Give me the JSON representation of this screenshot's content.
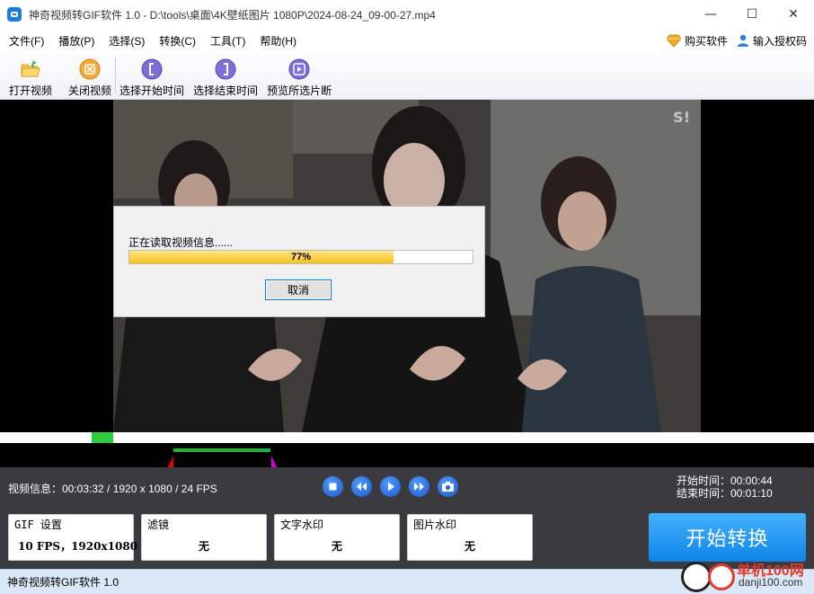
{
  "window": {
    "title": "神奇视频转GIF软件 1.0 - D:\\tools\\桌面\\4K壁纸图片 1080P\\2024-08-24_09-00-27.mp4",
    "controls": {
      "minimize": "—",
      "maximize": "☐",
      "close": "✕"
    }
  },
  "menu": {
    "items": [
      "文件(F)",
      "播放(P)",
      "选择(S)",
      "转换(C)",
      "工具(T)",
      "帮助(H)"
    ],
    "buy": "购买软件",
    "register": "输入授权码"
  },
  "toolbar": {
    "open": "打开视频",
    "close": "关闭视频",
    "select_start": "选择开始时间",
    "select_end": "选择结束时间",
    "preview": "预览所选片断"
  },
  "video": {
    "watermark": "S!"
  },
  "dialog": {
    "message": "正在读取视频信息......",
    "progress_percent": 77,
    "progress_label": "77%",
    "cancel": "取消"
  },
  "info": {
    "video_info": "视频信息：00:03:32 / 1920 x 1080 / 24 FPS",
    "start_time": "开始时间：00:00:44",
    "end_time": "结束时间：00:01:10"
  },
  "cards": {
    "gif": {
      "title": "GIF 设置",
      "value": "10 FPS，1920x1080"
    },
    "filter": {
      "title": "滤镜",
      "value": "无"
    },
    "text_wm": {
      "title": "文字水印",
      "value": "无"
    },
    "image_wm": {
      "title": "图片水印",
      "value": "无"
    }
  },
  "start_button": "开始转换",
  "status": "神奇视频转GIF软件 1.0",
  "brand": {
    "name": "单机100网",
    "url": "danji100.com"
  },
  "colors": {
    "accent": "#0d85e8",
    "progress": "#f6c21c",
    "timeline_marker": "#2ecc40",
    "range_start": "#e60000",
    "range_end": "#d400d4"
  }
}
